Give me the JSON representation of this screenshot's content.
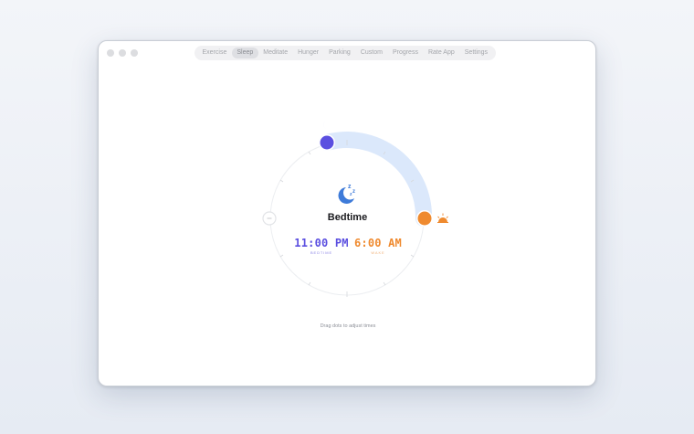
{
  "tabs": [
    {
      "label": "Exercise",
      "active": false
    },
    {
      "label": "Sleep",
      "active": true
    },
    {
      "label": "Meditate",
      "active": false
    },
    {
      "label": "Hunger",
      "active": false
    },
    {
      "label": "Parking",
      "active": false
    },
    {
      "label": "Custom",
      "active": false
    },
    {
      "label": "Progress",
      "active": false
    },
    {
      "label": "Rate App",
      "active": false
    },
    {
      "label": "Settings",
      "active": false
    }
  ],
  "dial": {
    "title": "Bedtime",
    "bedtime": {
      "time": "11:00 PM",
      "label": "BEDTIME",
      "color": "#5b4fe0"
    },
    "wake": {
      "time": "6:00 AM",
      "label": "WAKE",
      "color": "#ef8a2f"
    },
    "arc_color": "#dbe8fb",
    "icons": [
      "moon-icon",
      "sunrise-icon",
      "sleep-zzz-icon",
      "stopwatch-icon"
    ]
  },
  "hint": "Drag dots to adjust times"
}
